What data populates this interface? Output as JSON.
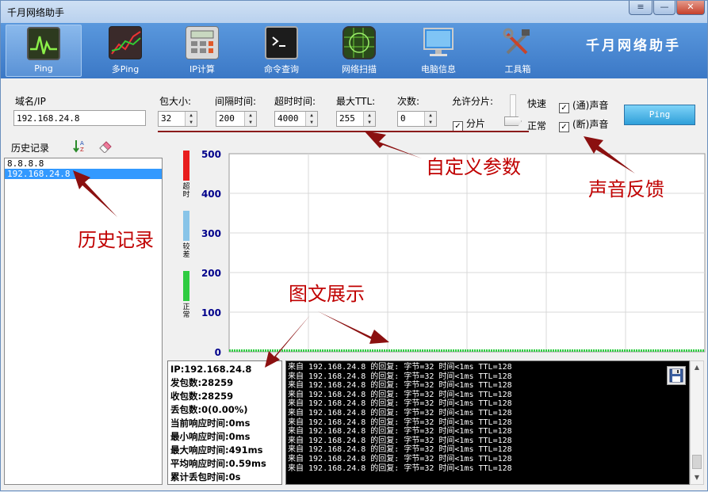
{
  "window": {
    "title": "千月网络助手",
    "brand": "千月网络助手",
    "menu_glyph": "≡",
    "min_glyph": "—",
    "close_glyph": "✕"
  },
  "toolbar": {
    "items": [
      {
        "label": "Ping",
        "icon": "ping-monitor-icon"
      },
      {
        "label": "多Ping",
        "icon": "multi-ping-chart-icon"
      },
      {
        "label": "IP计算",
        "icon": "calculator-icon"
      },
      {
        "label": "命令查询",
        "icon": "terminal-icon"
      },
      {
        "label": "网络扫描",
        "icon": "radar-icon"
      },
      {
        "label": "电脑信息",
        "icon": "computer-monitor-icon"
      },
      {
        "label": "工具箱",
        "icon": "tools-icon"
      }
    ],
    "active_index": 0
  },
  "params": {
    "domain_label": "域名/IP",
    "domain_value": "192.168.24.8",
    "packet_size_label": "包大小:",
    "packet_size_value": "32",
    "interval_label": "间隔时间:",
    "interval_value": "200",
    "timeout_label": "超时时间:",
    "timeout_value": "4000",
    "ttl_label": "最大TTL:",
    "ttl_value": "255",
    "count_label": "次数:",
    "count_value": "0",
    "fragment_label": "允许分片:",
    "fragment_checkbox_label": "分片",
    "fragment_checked": true,
    "speed_fast": "快速",
    "speed_normal": "正常",
    "sound_ok_label": "(通)声音",
    "sound_ok_checked": true,
    "sound_fail_label": "(断)声音",
    "sound_fail_checked": true,
    "ping_button": "Ping",
    "check_glyph": "✓",
    "spin_glyph": "▲\n▼"
  },
  "history": {
    "label": "历史记录",
    "items": [
      "8.8.8.8",
      "192.168.24.8"
    ],
    "selected_index": 1
  },
  "legend": [
    {
      "label": "超时",
      "color": "#e81c1c"
    },
    {
      "label": "较差",
      "color": "#88c4e8"
    },
    {
      "label": "正常",
      "color": "#2ecc40"
    }
  ],
  "chart_data": {
    "type": "line",
    "title": "",
    "xlabel": "",
    "ylabel": "",
    "ylim": [
      0,
      500
    ],
    "yticks": [
      0,
      100,
      200,
      300,
      400,
      500
    ],
    "grid": true,
    "series": [
      {
        "values": [
          0,
          0,
          0,
          0,
          0,
          0,
          0,
          0,
          0,
          0,
          0,
          0,
          0,
          0,
          0,
          0,
          0,
          0,
          0,
          0,
          0,
          0,
          0,
          0,
          0,
          0,
          0,
          0,
          0,
          0,
          0,
          0,
          0,
          0,
          0,
          0,
          0,
          0,
          0,
          0,
          0,
          0,
          0,
          0,
          0,
          0,
          0,
          0,
          0,
          0,
          0,
          0,
          0,
          0,
          0,
          0,
          0,
          0,
          0,
          0,
          0,
          0,
          0,
          0,
          0,
          0,
          0,
          0,
          0,
          0,
          0,
          0,
          0,
          0,
          0,
          0,
          0,
          0,
          0,
          0
        ],
        "color": "#2ecc40"
      }
    ],
    "tick_color": "#00008b"
  },
  "stats": {
    "ip": "IP:192.168.24.8",
    "sent": "发包数:28259",
    "received": "收包数:28259",
    "lost": "丢包数:0(0.00%)",
    "current": "当前响应时间:0ms",
    "min": "最小响应时间:0ms",
    "max": "最大响应时间:491ms",
    "avg": "平均响应时间:0.59ms",
    "lost_time": "累计丢包时间:0s"
  },
  "console": {
    "lines": [
      "来自 192.168.24.8 的回复: 字节=32 时间<1ms TTL=128",
      "来自 192.168.24.8 的回复: 字节=32 时间<1ms TTL=128",
      "来自 192.168.24.8 的回复: 字节=32 时间<1ms TTL=128",
      "来自 192.168.24.8 的回复: 字节=32 时间<1ms TTL=128",
      "来自 192.168.24.8 的回复: 字节=32 时间<1ms TTL=128",
      "来自 192.168.24.8 的回复: 字节=32 时间<1ms TTL=128",
      "来自 192.168.24.8 的回复: 字节=32 时间<1ms TTL=128",
      "来自 192.168.24.8 的回复: 字节=32 时间<1ms TTL=128",
      "来自 192.168.24.8 的回复: 字节=32 时间<1ms TTL=128",
      "来自 192.168.24.8 的回复: 字节=32 时间<1ms TTL=128",
      "来自 192.168.24.8 的回复: 字节=32 时间<1ms TTL=128",
      "来自 192.168.24.8 的回复: 字节=32 时间<1ms TTL=128"
    ]
  },
  "annotations": {
    "custom_params": "自定义参数",
    "sound_feedback": "声音反馈",
    "history_record": "历史记录",
    "graphic_display": "图文展示",
    "color": "#c00000"
  }
}
